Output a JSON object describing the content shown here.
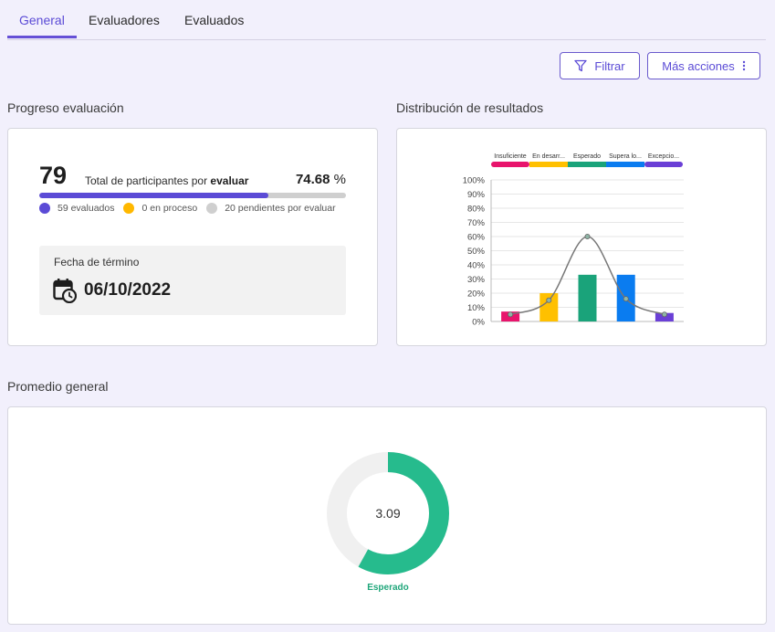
{
  "tabs": [
    {
      "label": "General",
      "active": true
    },
    {
      "label": "Evaluadores",
      "active": false
    },
    {
      "label": "Evaluados",
      "active": false
    }
  ],
  "toolbar": {
    "filter_label": "Filtrar",
    "more_label": "Más acciones"
  },
  "progress": {
    "section_title": "Progreso evaluación",
    "total": "79",
    "total_label_prefix": "Total de participantes por ",
    "total_label_bold": "evaluar",
    "percent_value": "74.68",
    "percent_sign": "%",
    "percent_fill": 74.68,
    "legend": [
      {
        "label": "59 evaluados",
        "color": "#5b4bd6"
      },
      {
        "label": "0 en proceso",
        "color": "#ffb800"
      },
      {
        "label": "20 pendientes por evaluar",
        "color": "#cfcfcf"
      }
    ],
    "date_label": "Fecha de término",
    "date_value": "06/10/2022"
  },
  "distribution": {
    "section_title": "Distribución de resultados"
  },
  "chart_data": {
    "type": "bar",
    "categories": [
      "Insuficiente",
      "En desarr...",
      "Esperado",
      "Supera lo...",
      "Excepcio..."
    ],
    "category_colors": [
      "#e8146c",
      "#ffc000",
      "#1aa37a",
      "#0a7cf0",
      "#6a3fd6"
    ],
    "values": [
      7,
      20,
      33,
      33,
      6
    ],
    "curve": [
      5,
      15,
      60,
      16,
      5
    ],
    "ylim": [
      0,
      100
    ],
    "yticks": [
      "0%",
      "10%",
      "20%",
      "30%",
      "40%",
      "50%",
      "60%",
      "70%",
      "80%",
      "90%",
      "100%"
    ],
    "grid": true
  },
  "average": {
    "section_title": "Promedio general",
    "value": "3.09",
    "label": "Esperado",
    "fraction": 0.58,
    "color": "#26bb8d",
    "track_color": "#f0f0f0"
  }
}
